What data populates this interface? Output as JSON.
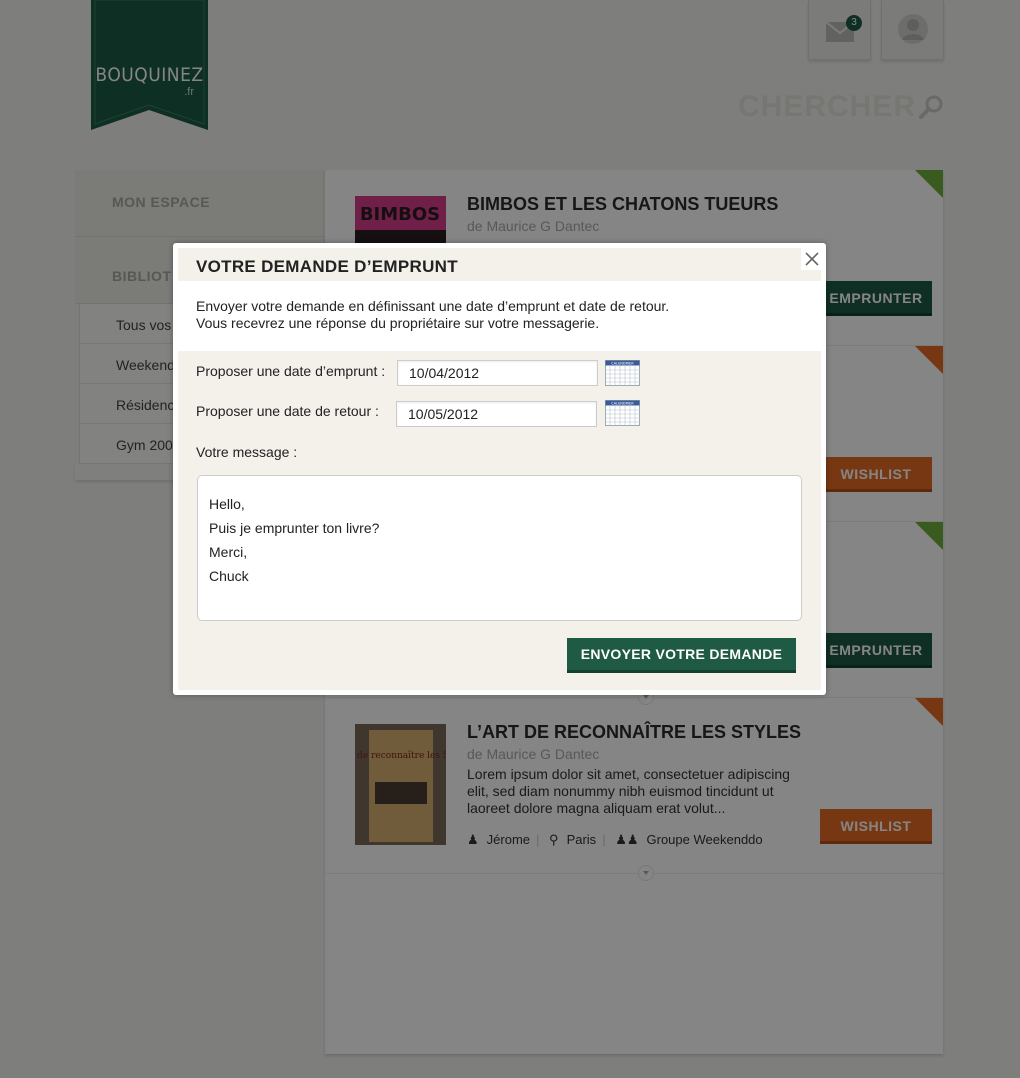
{
  "brand": {
    "name": "BOUQUINEZ",
    "suffix": ".fr"
  },
  "header": {
    "mail_count": "3",
    "search_label": "CHERCHER"
  },
  "sidebar": {
    "main_items": [
      "MON ESPACE",
      "BIBLIOT"
    ],
    "sub_items": [
      "Tous vos",
      "Weekend",
      "Résidenc",
      "Gym 200"
    ]
  },
  "books": [
    {
      "title": "BIMBOS ET LES CHATONS TUEURS",
      "author": "de Maurice G Dantec",
      "description": "",
      "action": "EMPRUNTER",
      "action_color": "green",
      "cover_text": "BIMBOS"
    },
    {
      "action": "WISHLIST",
      "action_color": "orange"
    },
    {
      "action": "EMPRUNTER",
      "action_color": "green"
    },
    {
      "title": "L’ART DE RECONNAÎTRE LES STYLES",
      "author": "de Maurice G Dantec",
      "description": "Lorem ipsum dolor sit amet, consectetuer adipiscing elit, sed diam nonummy nibh euismod tincidunt ut laoreet dolore magna aliquam erat volut...",
      "action": "WISHLIST",
      "action_color": "orange",
      "owner": "Jérome",
      "city": "Paris",
      "group": "Groupe Weekenddo",
      "cover_text": "L'Art de reconnaître les Styles"
    }
  ],
  "modal": {
    "title": "VOTRE DEMANDE D’EMPRUNT",
    "intro_line1": "Envoyer votre demande en définissant une date d’emprunt et date de retour.",
    "intro_line2": "Vous recevrez une réponse du propriétaire sur votre messagerie.",
    "borrow_label": "Proposer une date d’emprunt :",
    "borrow_value": "10/04/2012",
    "return_label": "Proposer une date de retour :",
    "return_value": "10/05/2012",
    "message_label": "Votre message :",
    "message_value": "Hello,\nPuis je emprunter ton livre?\nMerci,\nChuck",
    "submit_label": "ENVOYER VOTRE DEMANDE",
    "calendar_icon_text": "CALENDRIER"
  },
  "colors": {
    "brand_green": "#1f5a45",
    "accent_orange": "#e66a26",
    "ribbon_green": "#6fae3c"
  }
}
